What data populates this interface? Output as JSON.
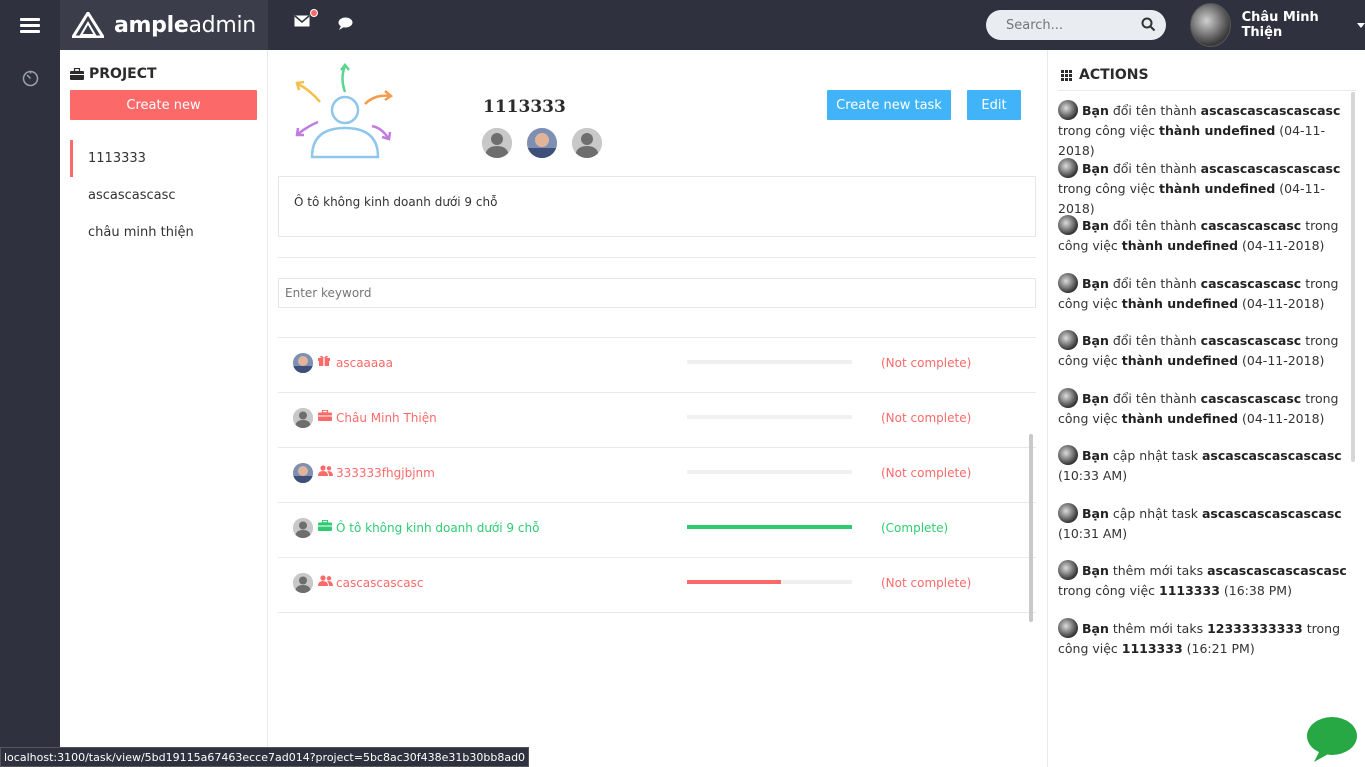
{
  "topbar": {
    "brand_bold": "ample",
    "brand_light": "admin",
    "search_placeholder": "Search...",
    "user_name": "Châu Minh Thiện",
    "colors": {
      "bar": "#2f323e",
      "accent": "#fb6a69",
      "info": "#41b3f9"
    }
  },
  "project": {
    "title": "PROJECT",
    "create_label": "Create new",
    "items": [
      "1113333",
      "ascascascasc",
      "châu minh thiện"
    ]
  },
  "task": {
    "title": "1113333",
    "create_task_label": "Create new task",
    "edit_label": "Edit",
    "description": "Ô tô không kinh doanh dưới 9 chỗ",
    "keyword_placeholder": "Enter keyword",
    "rows": [
      {
        "name": "ascaaaaa",
        "status": "(Not complete)",
        "progress": 0,
        "icon": "gift-icon",
        "state": "red"
      },
      {
        "name": "Châu Minh Thiện",
        "status": "(Not complete)",
        "progress": 0,
        "icon": "briefcase-icon",
        "state": "red"
      },
      {
        "name": "333333fhgjbjnm",
        "status": "(Not complete)",
        "progress": 0,
        "icon": "users-icon",
        "state": "red"
      },
      {
        "name": "Ô tô không kinh doanh dưới 9 chỗ",
        "status": "(Complete)",
        "progress": 1,
        "icon": "briefcase-icon",
        "state": "green"
      },
      {
        "name": "cascascascasc",
        "status": "(Not complete)",
        "progress": 0.57,
        "icon": "users-icon",
        "state": "red"
      }
    ]
  },
  "actions": {
    "title": "ACTIONS",
    "items": [
      {
        "who": "Bạn",
        "text1": " đổi tên thành ",
        "bold1": "ascascascascascasc",
        "text2": " trong công việc ",
        "bold2": "thành undefined",
        "text3": " (04-11-2018)"
      },
      {
        "who": "Bạn",
        "text1": " đổi tên thành ",
        "bold1": "ascascascascascasc",
        "text2": " trong công việc ",
        "bold2": "thành undefined",
        "text3": " (04-11-2018)"
      },
      {
        "who": "Bạn",
        "text1": " đổi tên thành ",
        "bold1": "cascascascasc",
        "text2": " trong công việc ",
        "bold2": "thành undefined",
        "text3": " (04-11-2018)"
      },
      {
        "who": "Bạn",
        "text1": " đổi tên thành ",
        "bold1": "cascascascasc",
        "text2": " trong công việc ",
        "bold2": "thành undefined",
        "text3": " (04-11-2018)"
      },
      {
        "who": "Bạn",
        "text1": " đổi tên thành ",
        "bold1": "cascascascasc",
        "text2": " trong công việc ",
        "bold2": "thành undefined",
        "text3": " (04-11-2018)"
      },
      {
        "who": "Bạn",
        "text1": " đổi tên thành ",
        "bold1": "cascascascasc",
        "text2": " trong công việc ",
        "bold2": "thành undefined",
        "text3": " (04-11-2018)"
      },
      {
        "who": "Bạn",
        "text1": " cập nhật task ",
        "bold1": "ascascascascascasc",
        "text2": " ",
        "bold2": "",
        "text3": "(10:33 AM)"
      },
      {
        "who": "Bạn",
        "text1": " cập nhật task ",
        "bold1": "ascascascascascasc",
        "text2": " ",
        "bold2": "",
        "text3": "(10:31 AM)"
      },
      {
        "who": "Bạn",
        "text1": " thêm mới taks ",
        "bold1": "ascascascascascasc",
        "text2": " trong công việc ",
        "bold2": "1113333",
        "text3": " (16:38 PM)"
      },
      {
        "who": "Bạn",
        "text1": " thêm mới taks ",
        "bold1": "12333333333",
        "text2": " trong công việc ",
        "bold2": "1113333",
        "text3": " (16:21 PM)"
      }
    ]
  },
  "status_url": "localhost:3100/task/view/5bd19115a67463ecce7ad014?project=5bc8ac30f438e31b30bb8ad0"
}
